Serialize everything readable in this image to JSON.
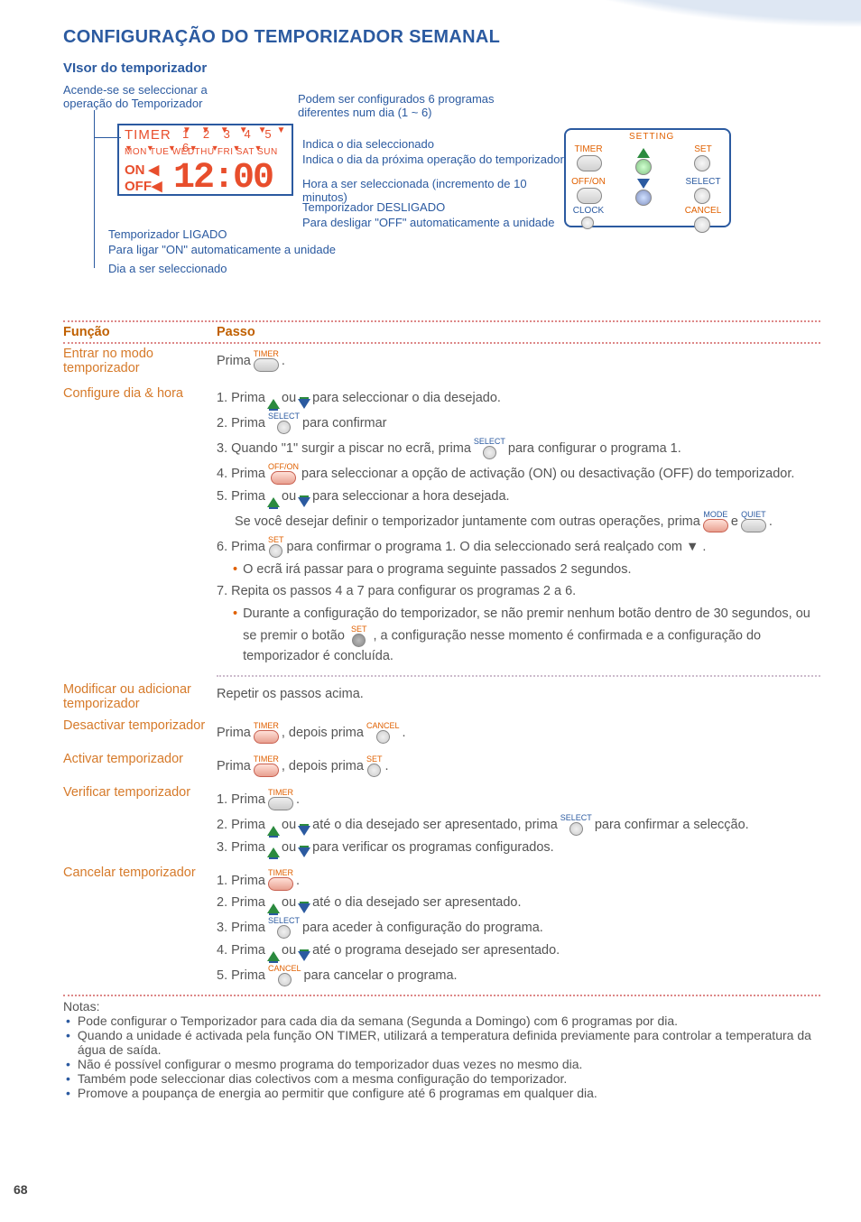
{
  "page": {
    "number": "68",
    "title": "CONFIGURAÇÃO DO TEMPORIZADOR SEMANAL",
    "subtitle": "VIsor do temporizador"
  },
  "diagram": {
    "call_topleft": "Acende-se se seleccionar a operação do Temporizador",
    "call_prog": "Podem ser configurados 6 programas diferentes num dia (1 ~ 6)",
    "call_dayselect": "Indica o dia seleccionado",
    "call_nextday": "Indica o dia da próxima operação do temporizador",
    "call_hour": "Hora a ser seleccionada (incremento de 10 minutos)",
    "call_off": "Temporizador DESLIGADO",
    "call_off2": "Para desligar \"OFF\" automaticamente a unidade",
    "call_on": "Temporizador LIGADO",
    "call_on2": "Para ligar \"ON\" automaticamente a unidade",
    "call_daytobe": "Dia a ser seleccionado",
    "lcd": {
      "timer": "TIMER",
      "progs": "1 2 3 4 5 6",
      "days": "MON TUE WEDTHU FRI SAT SUN",
      "on": "ON ◀",
      "off": "OFF◀",
      "time": "12:00"
    },
    "remote": {
      "setting": "SETTING",
      "timer": "TIMER",
      "set": "SET",
      "offon": "OFF/ON",
      "select": "SELECT",
      "clock": "CLOCK",
      "cancel": "CANCEL"
    }
  },
  "table": {
    "hdr_func": "Função",
    "hdr_step": "Passo",
    "r1_func": "Entrar no modo temporizador",
    "r1_s1a": "Prima ",
    "r1_s1b": ".",
    "r2_func": "Configure dia & hora",
    "r2_s1a": "1.  Prima ",
    "r2_s1b": " ou ",
    "r2_s1c": " para seleccionar o dia desejado.",
    "r2_s2a": "2.  Prima ",
    "r2_s2b": " para confirmar",
    "r2_s3a": "3.  Quando \"1\" surgir a piscar no ecrã, prima ",
    "r2_s3b": " para configurar o programa 1.",
    "r2_s4a": "4.  Prima ",
    "r2_s4b": " para seleccionar a opção de activação (ON) ou desactivação (OFF) do temporizador.",
    "r2_s5a": "5.  Prima ",
    "r2_s5b": " ou ",
    "r2_s5c": " para seleccionar a hora desejada.",
    "r2_s5d": "Se você desejar definir o temporizador juntamente com outras operações, prima ",
    "r2_s5e": " e ",
    "r2_s5f": ".",
    "r2_s6a": "6.  Prima ",
    "r2_s6b": " para confirmar o programa 1. O dia seleccionado será realçado com ▼ .",
    "r2_s6c": "O ecrã irá passar para o programa seguinte passados 2 segundos.",
    "r2_s7a": "7.  Repita os passos 4 a 7 para configurar os programas 2 a 6.",
    "r2_s7b": "Durante a configuração do temporizador, se não premir nenhum botão dentro de 30 segundos, ou se premir o botão ",
    "r2_s7c": " , a configuração nesse momento é confirmada e a configuração do temporizador é concluída.",
    "r3_func": "Modificar ou adicionar temporizador",
    "r3_s1": "Repetir os passos acima.",
    "r4_func": "Desactivar temporizador",
    "r4_s1a": "Prima ",
    "r4_s1b": ", depois prima ",
    "r4_s1c": " .",
    "r5_func": "Activar temporizador",
    "r5_s1a": "Prima ",
    "r5_s1b": ", depois prima ",
    "r5_s1c": ".",
    "r6_func": "Verificar temporizador",
    "r6_s1a": "1.  Prima ",
    "r6_s1b": ".",
    "r6_s2a": "2.  Prima ",
    "r6_s2b": " ou ",
    "r6_s2c": " até o dia desejado ser apresentado, prima ",
    "r6_s2d": " para confirmar a selecção.",
    "r6_s3a": "3.  Prima ",
    "r6_s3b": " ou ",
    "r6_s3c": " para verificar os programas configurados.",
    "r7_func": "Cancelar temporizador",
    "r7_s1a": "1.  Prima ",
    "r7_s1b": ".",
    "r7_s2a": "2. Prima ",
    "r7_s2b": " ou ",
    "r7_s2c": " até o dia desejado ser apresentado.",
    "r7_s3a": "3.  Prima ",
    "r7_s3b": " para aceder à configuração do programa.",
    "r7_s4a": "4.  Prima ",
    "r7_s4b": " ou ",
    "r7_s4c": " até o programa desejado ser apresentado.",
    "r7_s5a": "5.  Prima ",
    "r7_s5b": " para cancelar o programa."
  },
  "notes": {
    "title": "Notas:",
    "n1": "Pode configurar o Temporizador para cada dia da semana (Segunda a Domingo) com 6 programas por dia.",
    "n2": "Quando a unidade é activada pela função ON TIMER, utilizará a temperatura definida previamente para controlar a temperatura da água de saída.",
    "n3": "Não é possível configurar o mesmo programa do temporizador duas vezes no mesmo dia.",
    "n4": "Também pode seleccionar dias colectivos com a mesma configuração do temporizador.",
    "n5": "Promove a poupança de energia ao permitir que configure até 6 programas em qualquer dia."
  },
  "btn_labels": {
    "timer": "TIMER",
    "select": "SELECT",
    "offon": "OFF/ON",
    "set": "SET",
    "cancel": "CANCEL",
    "mode": "MODE",
    "quiet": "QUIET"
  }
}
